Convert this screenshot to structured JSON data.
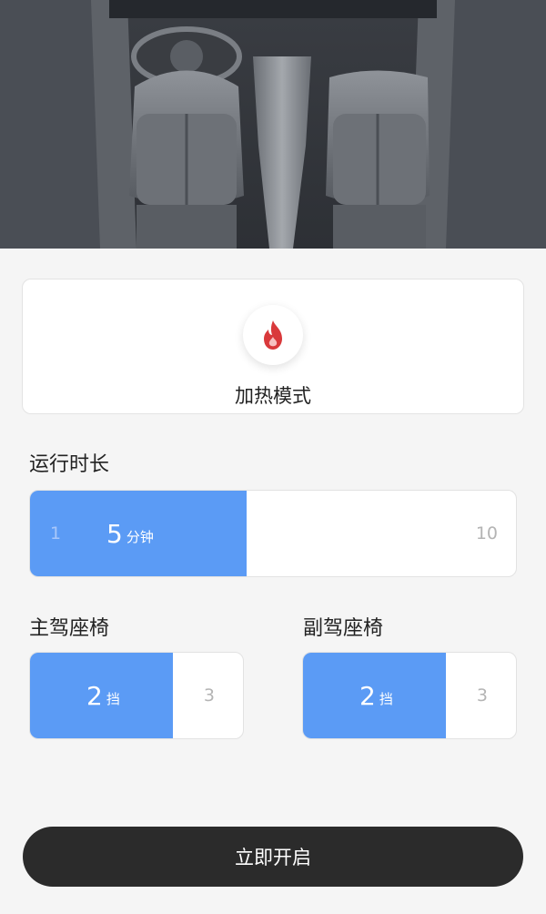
{
  "hero": {
    "image": "car-interior-seats"
  },
  "mode": {
    "label": "加热模式",
    "icon": "flame-icon",
    "icon_color": "#d9393b"
  },
  "duration": {
    "title": "运行时长",
    "min": "1",
    "max": "10",
    "value": "5",
    "unit": "分钟",
    "fill_fraction": 0.444,
    "accent": "#5b9bf5"
  },
  "driver_seat": {
    "title": "主驾座椅",
    "value": "2",
    "unit": "挡",
    "max": "3",
    "fill_fraction": 0.67
  },
  "passenger_seat": {
    "title": "副驾座椅",
    "value": "2",
    "unit": "挡",
    "max": "3",
    "fill_fraction": 0.67
  },
  "start_button": {
    "label": "立即开启"
  }
}
